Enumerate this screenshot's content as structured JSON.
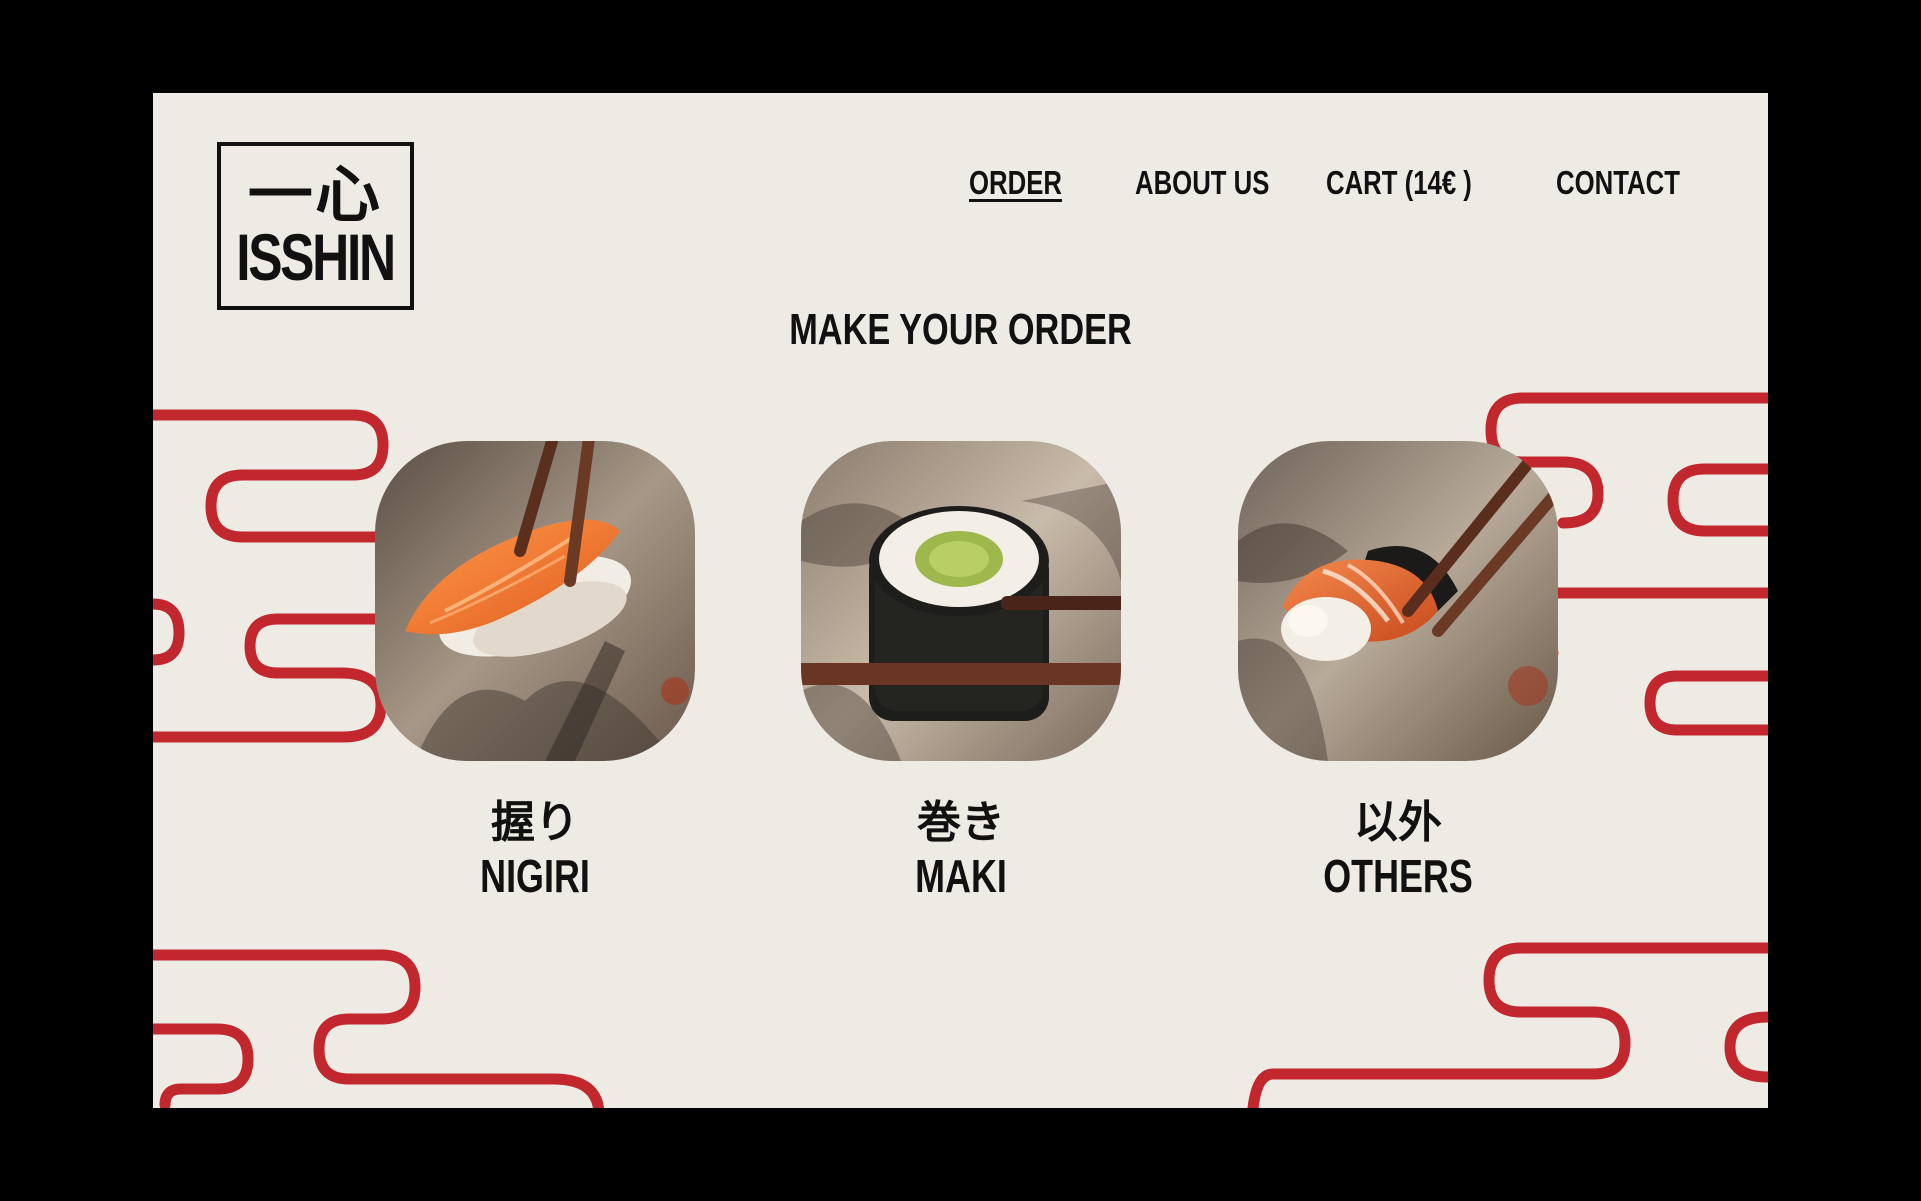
{
  "brand": {
    "kanji": "一心",
    "name": "ISSHIN"
  },
  "nav": {
    "items": [
      {
        "label": "ORDER",
        "active": true
      },
      {
        "label": "ABOUT US",
        "active": false
      },
      {
        "label": "CART (14€ )",
        "active": false
      },
      {
        "label": "CONTACT",
        "active": false
      }
    ]
  },
  "main": {
    "title": "MAKE YOUR ORDER",
    "categories": [
      {
        "jp": "握り",
        "en": "NIGIRI",
        "image": "nigiri-photo"
      },
      {
        "jp": "巻き",
        "en": "MAKI",
        "image": "maki-photo"
      },
      {
        "jp": "以外",
        "en": "OTHERS",
        "image": "others-photo"
      }
    ]
  },
  "colors": {
    "background": "#eeebe5",
    "accent": "#c1272d",
    "text": "#111111",
    "frame": "#000000"
  }
}
